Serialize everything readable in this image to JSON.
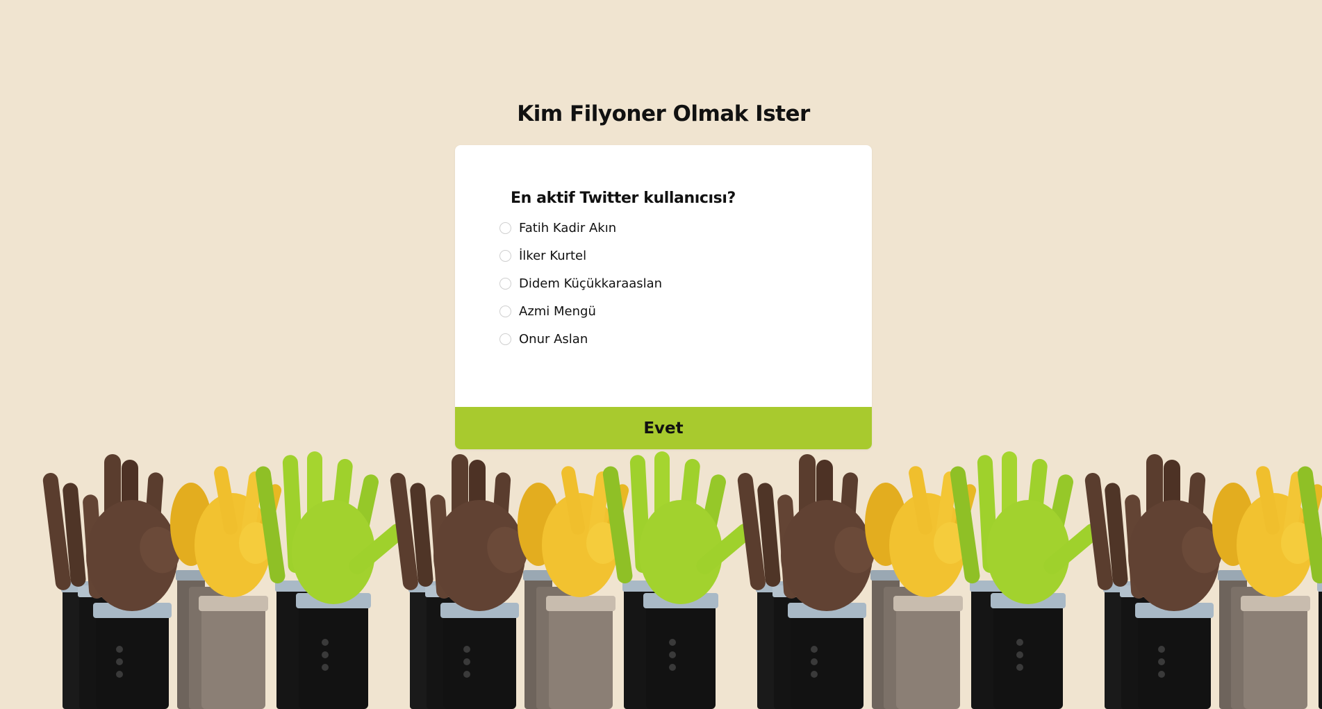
{
  "page": {
    "title": "Kim Filyoner Olmak Ister"
  },
  "quiz": {
    "question": "En aktif Twitter kullanıcısı?",
    "options": [
      "Fatih Kadir Akın",
      "İlker Kurtel",
      "Didem Küçükkaraaslan",
      "Azmi Mengü",
      "Onur Aslan"
    ],
    "submit_label": "Evet"
  },
  "colors": {
    "background": "#f0e4d0",
    "card": "#ffffff",
    "button": "#a8ca2e",
    "hand_dark": "#5a3d2e",
    "hand_yellow": "#f2c230",
    "hand_green": "#9fd12c",
    "sleeve_black": "#121212",
    "sleeve_grey": "#8b7f75",
    "cuff": "#a9b9c6"
  },
  "illustration": {
    "icon": "raised-hands-illustration"
  }
}
